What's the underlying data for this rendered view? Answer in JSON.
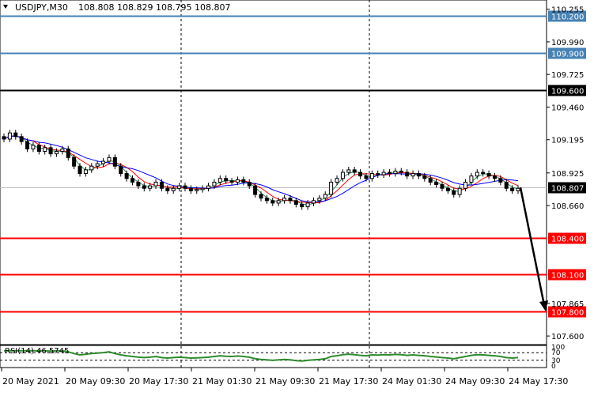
{
  "header": {
    "symbol": "USDJPY,M30",
    "ohlc": "108.808 108.829 108.795 108.807",
    "indicator": "RSI(14) 46.5745"
  },
  "price_scale": {
    "ticks": [
      "110.255",
      "109.990",
      "109.725",
      "109.460",
      "109.195",
      "108.925",
      "108.660",
      "107.865",
      "107.600"
    ],
    "rsi_ticks": [
      "100",
      "70",
      "30",
      "0"
    ]
  },
  "levels": [
    {
      "label": "110.200",
      "value": 110.2,
      "color": "#4682b4",
      "kind": "resistance"
    },
    {
      "label": "109.900",
      "value": 109.9,
      "color": "#4682b4",
      "kind": "resistance"
    },
    {
      "label": "109.600",
      "value": 109.6,
      "color": "#000000",
      "kind": "resistance"
    },
    {
      "label": "108.400",
      "value": 108.4,
      "color": "#ff0000",
      "kind": "support"
    },
    {
      "label": "108.100",
      "value": 108.1,
      "color": "#ff0000",
      "kind": "support"
    },
    {
      "label": "107.800",
      "value": 107.8,
      "color": "#ff0000",
      "kind": "support"
    }
  ],
  "current_price": {
    "label": "108.807",
    "value": 108.807
  },
  "time_axis": [
    "20 May 2021",
    "20 May 09:30",
    "20 May 17:30",
    "21 May 01:30",
    "21 May 09:30",
    "21 May 17:30",
    "24 May 01:30",
    "24 May 09:30",
    "24 May 17:30"
  ],
  "forecast_arrow": {
    "from": 108.807,
    "to": 107.8
  },
  "chart_data": {
    "type": "candlestick",
    "symbol": "USDJPY",
    "timeframe": "M30",
    "ylim": [
      107.53,
      110.33
    ],
    "close": [
      109.2,
      109.25,
      109.22,
      109.18,
      109.12,
      109.15,
      109.1,
      109.13,
      109.08,
      109.1,
      109.12,
      109.05,
      108.98,
      108.92,
      108.95,
      108.98,
      109.0,
      109.02,
      109.05,
      108.98,
      108.92,
      108.88,
      108.85,
      108.82,
      108.8,
      108.82,
      108.85,
      108.8,
      108.78,
      108.8,
      108.82,
      108.8,
      108.78,
      108.79,
      108.8,
      108.82,
      108.85,
      108.88,
      108.86,
      108.85,
      108.87,
      108.85,
      108.82,
      108.75,
      108.72,
      108.7,
      108.68,
      108.7,
      108.72,
      108.7,
      108.67,
      108.65,
      108.68,
      108.7,
      108.72,
      108.75,
      108.85,
      108.88,
      108.93,
      108.95,
      108.93,
      108.9,
      108.88,
      108.92,
      108.91,
      108.93,
      108.92,
      108.94,
      108.93,
      108.9,
      108.92,
      108.9,
      108.88,
      108.85,
      108.83,
      108.8,
      108.78,
      108.75,
      108.8,
      108.85,
      108.9,
      108.93,
      108.92,
      108.9,
      108.88,
      108.85,
      108.8,
      108.78,
      108.8
    ],
    "series": [
      {
        "name": "MA fast",
        "color": "#2e8b57"
      },
      {
        "name": "MA medium",
        "color": "#ff0000"
      },
      {
        "name": "MA slow",
        "color": "#0000ff"
      },
      {
        "name": "RSI(14)",
        "color": "#2e8b2e"
      }
    ],
    "rsi_range": [
      0,
      100
    ]
  }
}
